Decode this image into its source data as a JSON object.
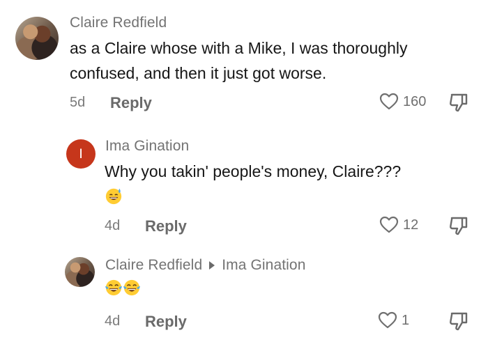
{
  "comments": [
    {
      "username": "Claire Redfield",
      "text_line1": "as a Claire whose with a Mike, I was thoroughly",
      "text_line2": "confused, and then it just got worse.",
      "age": "5d",
      "reply_label": "Reply",
      "likes": "160",
      "avatar": "photo"
    },
    {
      "username": "Ima Gination",
      "avatar_letter": "I",
      "text": "Why you takin' people's money, Claire???",
      "emojis": [
        "sweat-smile-emoji"
      ],
      "age": "4d",
      "reply_label": "Reply",
      "likes": "12"
    },
    {
      "username": "Claire Redfield",
      "reply_to": "Ima Gination",
      "emojis": [
        "tears-of-joy-emoji",
        "tears-of-joy-emoji"
      ],
      "age": "4d",
      "reply_label": "Reply",
      "likes": "1",
      "avatar": "photo"
    }
  ],
  "colors": {
    "avatar_letter_bg": "#c6361b",
    "username": "#737373",
    "text": "#161616",
    "meta": "#7a7a7a"
  },
  "icons": {
    "like": "heart-outline-icon",
    "dislike": "thumbs-down-icon",
    "reply_arrow": "triangle-right-icon"
  }
}
